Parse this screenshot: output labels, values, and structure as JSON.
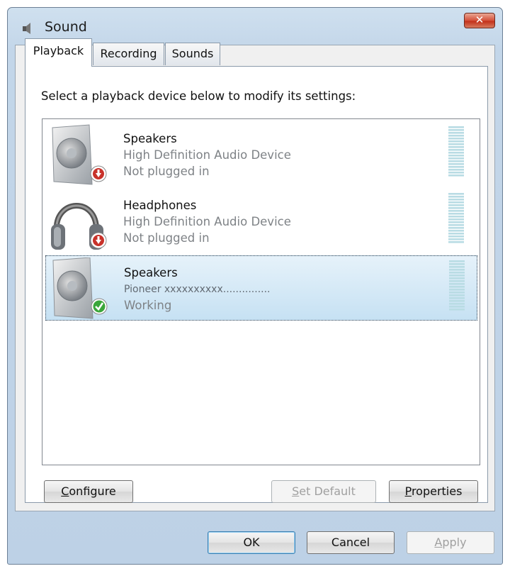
{
  "window": {
    "title": "Sound",
    "close_glyph": "✕",
    "title_icon": "speaker-icon"
  },
  "tabs": [
    {
      "label": "Playback",
      "active": true
    },
    {
      "label": "Recording",
      "active": false
    },
    {
      "label": "Sounds",
      "active": false
    }
  ],
  "instruction": "Select a playback device below to modify its settings:",
  "devices": [
    {
      "name": "Speakers",
      "description": "High Definition Audio Device",
      "status": "Not plugged in",
      "icon": "speaker-icon",
      "badge": "unplugged-badge-icon",
      "selected": false
    },
    {
      "name": "Headphones",
      "description": "High Definition Audio Device",
      "status": "Not plugged in",
      "icon": "headphones-icon",
      "badge": "unplugged-badge-icon",
      "selected": false
    },
    {
      "name": "Speakers",
      "description": "Pioneer xxxxxxxxxx...............",
      "status": "Working",
      "icon": "speaker-icon",
      "badge": "working-check-icon",
      "selected": true
    }
  ],
  "buttons": {
    "configure": {
      "label": "Configure",
      "mnemonic": "C",
      "rest": "onfigure"
    },
    "set_default": {
      "label": "Set Default",
      "mnemonic": "S",
      "rest": "et Default",
      "disabled": true
    },
    "properties": {
      "label": "Properties",
      "mnemonic": "P",
      "rest": "roperties"
    },
    "ok": {
      "label": "OK"
    },
    "cancel": {
      "label": "Cancel"
    },
    "apply": {
      "label": "Apply",
      "mnemonic": "A",
      "rest": "pply",
      "disabled": true
    }
  },
  "colors": {
    "selection": "#c6e1f3",
    "meter": "#b9dce4",
    "unplugged_badge": "#c8322a",
    "working_badge": "#3aa63a"
  }
}
